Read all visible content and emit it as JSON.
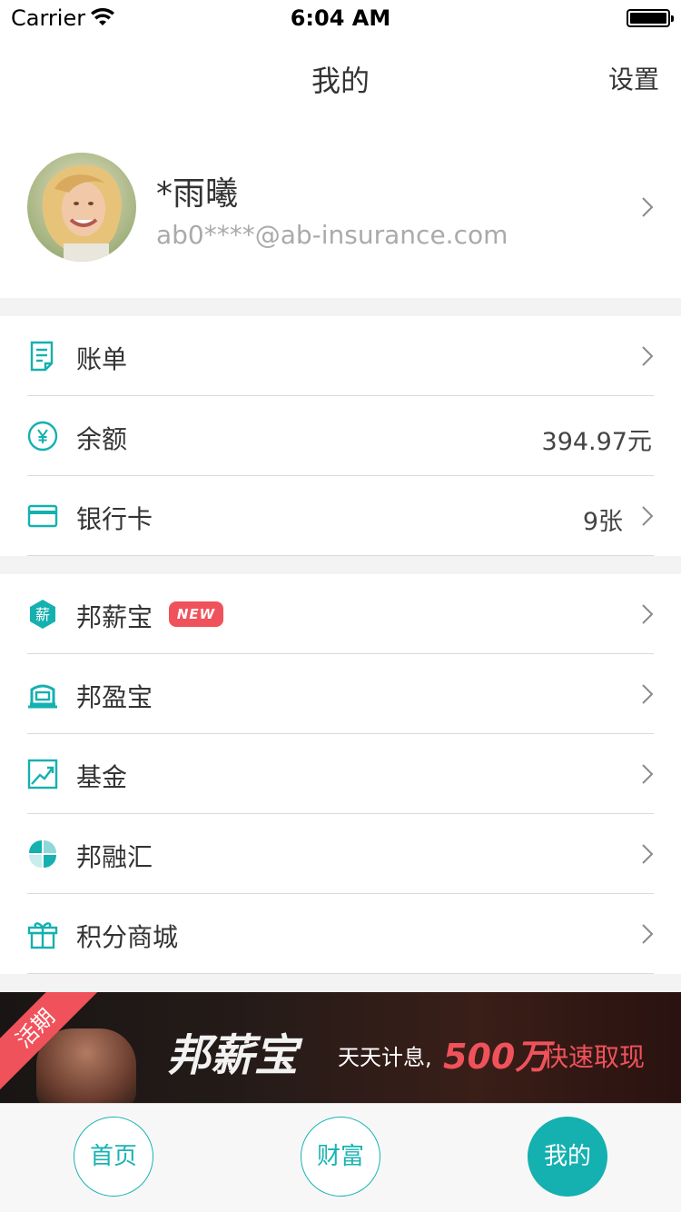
{
  "status_bar": {
    "carrier": "Carrier",
    "time": "6:04 AM"
  },
  "nav": {
    "title": "我的",
    "settings": "设置"
  },
  "profile": {
    "name": "*雨曦",
    "email": "ab0****@ab-insurance.com"
  },
  "account": [
    {
      "icon": "bill-icon",
      "label": "账单",
      "value": "",
      "chevron": true
    },
    {
      "icon": "yen-icon",
      "label": "余额",
      "value": "394.97元",
      "chevron": false
    },
    {
      "icon": "card-icon",
      "label": "银行卡",
      "value": "9张",
      "chevron": true
    }
  ],
  "products": [
    {
      "icon": "salary-icon",
      "label": "邦薪宝",
      "badge": "NEW"
    },
    {
      "icon": "vault-icon",
      "label": "邦盈宝",
      "badge": ""
    },
    {
      "icon": "chart-trend-icon",
      "label": "基金",
      "badge": ""
    },
    {
      "icon": "leaf-icon",
      "label": "邦融汇",
      "badge": ""
    },
    {
      "icon": "gift-icon",
      "label": "积分商城",
      "badge": ""
    }
  ],
  "banner": {
    "ribbon": "活期",
    "title": "邦薪宝",
    "sub1": "天天计息,",
    "amount": "500万",
    "sub2": "快速取现"
  },
  "tabs": [
    {
      "label": "首页",
      "active": false
    },
    {
      "label": "财富",
      "active": false
    },
    {
      "label": "我的",
      "active": true
    }
  ],
  "colors": {
    "accent": "#15b0b0",
    "badge": "#f0525b"
  }
}
